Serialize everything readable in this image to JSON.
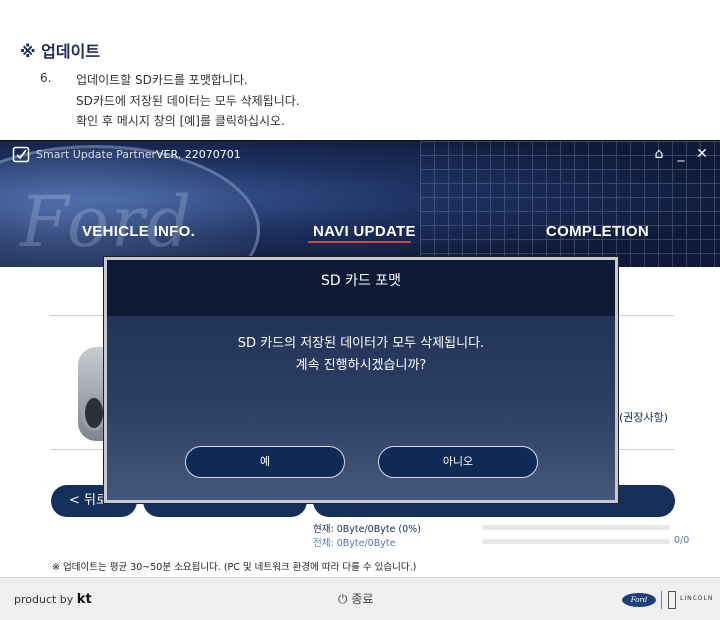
{
  "doc": {
    "title": "※ 업데이트",
    "step_number": "6.",
    "lines": [
      "업데이트할 SD카드를 포맷합니다.",
      "SD카드에 저장된 데이터는 모두 삭제됩니다.",
      "확인 후 메시지 창의 [예]를 클릭하십시오."
    ]
  },
  "app": {
    "name": "Smart Update Partner",
    "version": "VER. 22070701",
    "window_buttons": {
      "home": "⌂",
      "minimize": "_",
      "close": "✕"
    },
    "banner_script": "Ford",
    "steps": [
      "VEHICLE INFO.",
      "NAVI UPDATE",
      "COMPLETION"
    ],
    "active_step": "NAVI UPDATE",
    "recommend": "(권장사항)",
    "back_button": "< 뒤로",
    "progress": {
      "current_label": "현재: 0Byte/0Byte  (0%)",
      "total_label": "전체: 0Byte/0Byte",
      "total_count": "0/0",
      "current_fraction": 0,
      "total_fraction": 0
    },
    "note": "※ 업데이트는 평균 30~50분 소요됩니다. (PC 및 네트워크 환경에 따라 다를 수 있습니다.)",
    "footer": {
      "product_by": "product by",
      "kt": "kt",
      "exit_icon": "⏻",
      "exit_label": "종료",
      "ford": "Ford",
      "lincoln": "LINCOLN"
    }
  },
  "dialog": {
    "title": "SD 카드 포맷",
    "message_line1": "SD 카드의 저장된 데이터가 모두 삭제됩니다.",
    "message_line2": "계속 진행하시겠습니까?",
    "yes_label": "예",
    "no_label": "아니오"
  },
  "colors": {
    "navy": "#14305a",
    "accent_red": "#e0403f",
    "progress_blue": "#5077b8"
  }
}
